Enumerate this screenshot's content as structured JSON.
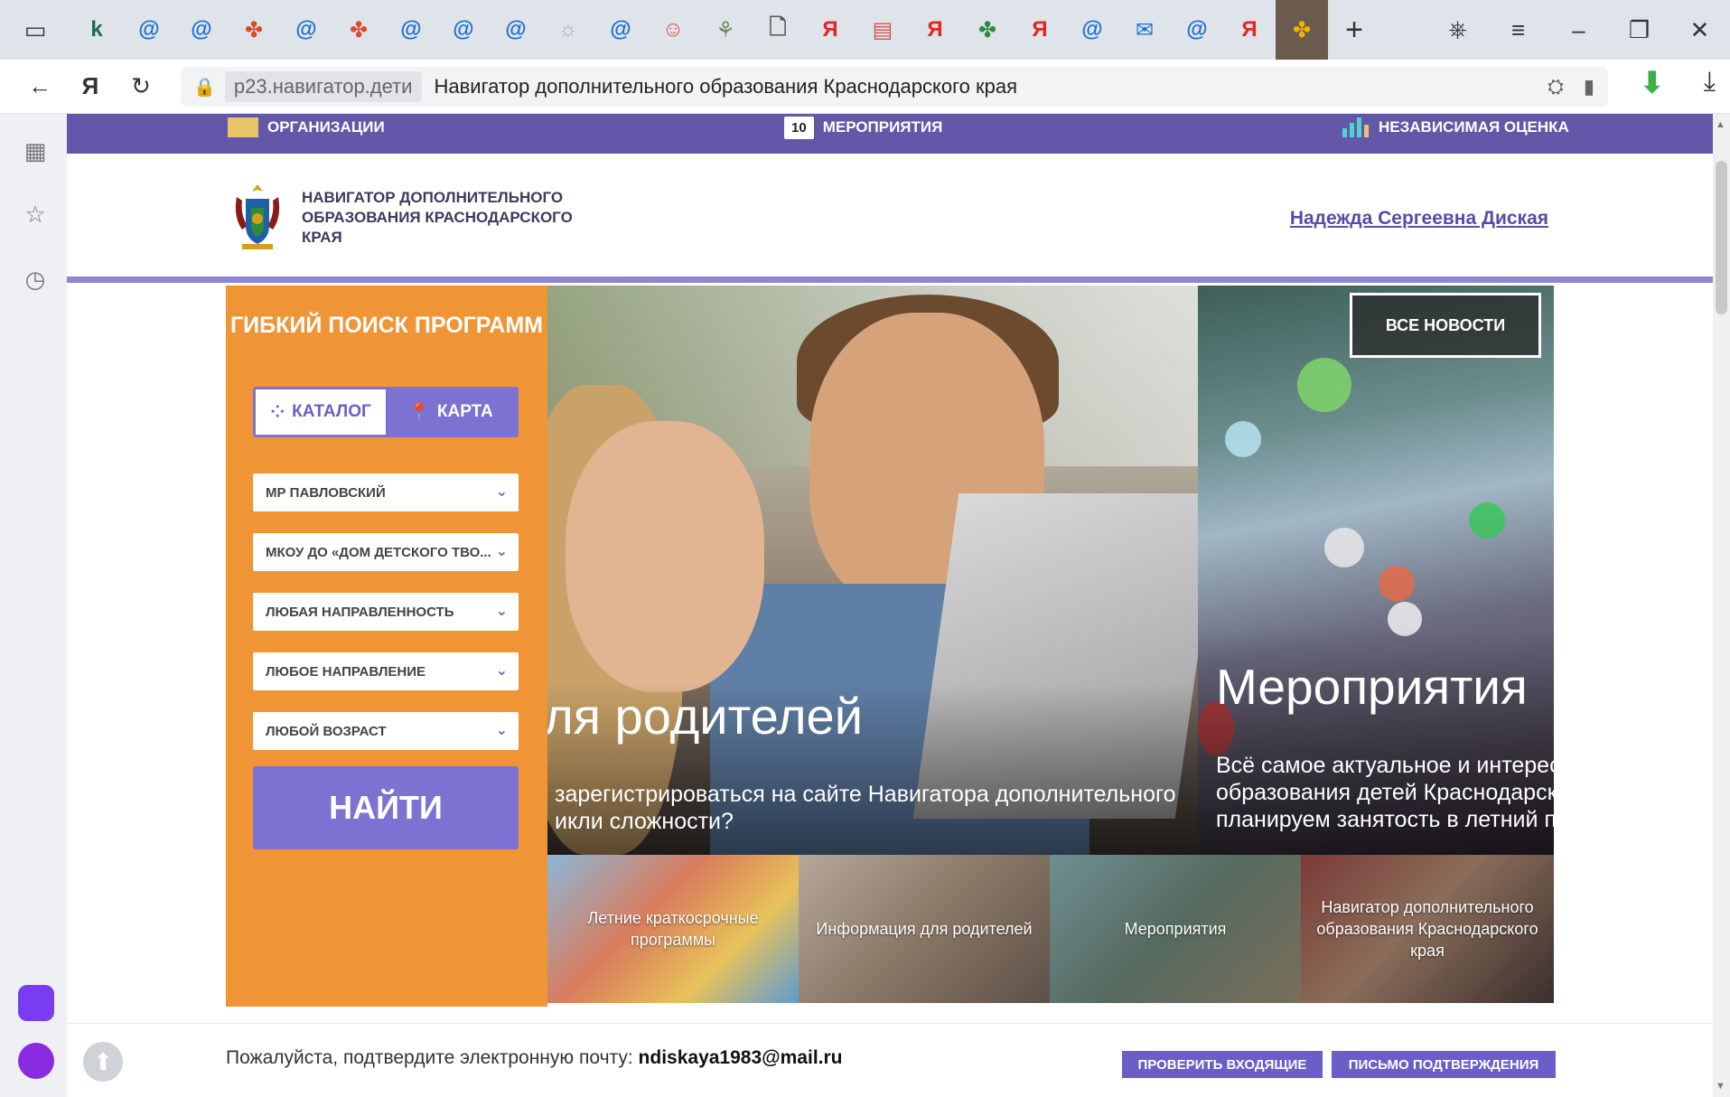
{
  "browser": {
    "tabs": [
      {
        "icon": "sidebar-toggle-icon",
        "glyph": "▭"
      },
      {
        "icon": "k-icon",
        "glyph": "k",
        "color": "#1f6b4a"
      },
      {
        "icon": "mail-icon",
        "glyph": "@",
        "color": "#1a6fd1"
      },
      {
        "icon": "mail-icon",
        "glyph": "@",
        "color": "#1a6fd1"
      },
      {
        "icon": "navigator-icon",
        "glyph": "✤",
        "color": "#d94b2b"
      },
      {
        "icon": "mail-icon",
        "glyph": "@",
        "color": "#1a6fd1"
      },
      {
        "icon": "navigator-icon",
        "glyph": "✤",
        "color": "#d94b2b"
      },
      {
        "icon": "mail-icon",
        "glyph": "@",
        "color": "#1a6fd1"
      },
      {
        "icon": "mail-icon",
        "glyph": "@",
        "color": "#1a6fd1"
      },
      {
        "icon": "mail-icon",
        "glyph": "@",
        "color": "#1a6fd1"
      },
      {
        "icon": "site-icon",
        "glyph": "☼",
        "color": "#b0b0b0"
      },
      {
        "icon": "mail-icon",
        "glyph": "@",
        "color": "#1a6fd1"
      },
      {
        "icon": "face-icon",
        "glyph": "☺",
        "color": "#d9534f"
      },
      {
        "icon": "figure-icon",
        "glyph": "⚘",
        "color": "#6a8a5a"
      },
      {
        "icon": "document-icon",
        "glyph": "🗋",
        "color": "#555555"
      },
      {
        "icon": "yandex-icon",
        "glyph": "Я",
        "color": "#e52620"
      },
      {
        "icon": "book-icon",
        "glyph": "▤",
        "color": "#d9534f"
      },
      {
        "icon": "yandex-icon",
        "glyph": "Я",
        "color": "#e52620"
      },
      {
        "icon": "navigator-icon",
        "glyph": "✤",
        "color": "#2b8a3e"
      },
      {
        "icon": "yandex-icon",
        "glyph": "Я",
        "color": "#e52620"
      },
      {
        "icon": "mail-icon",
        "glyph": "@",
        "color": "#1a6fd1"
      },
      {
        "icon": "envelope-icon",
        "glyph": "✉",
        "color": "#1a6fd1"
      },
      {
        "icon": "mail-icon",
        "glyph": "@",
        "color": "#1a6fd1"
      },
      {
        "icon": "yandex-icon",
        "glyph": "Я",
        "color": "#e52620"
      },
      {
        "icon": "navigator-icon",
        "glyph": "✤",
        "color": "#f0b400",
        "active": true
      }
    ],
    "new_tab_glyph": "+",
    "window_controls": [
      {
        "icon": "bookmarks-collection-icon",
        "glyph": "⎈"
      },
      {
        "icon": "menu-icon",
        "glyph": "≡"
      },
      {
        "icon": "minimize-icon",
        "glyph": "–"
      },
      {
        "icon": "restore-icon",
        "glyph": "❐"
      },
      {
        "icon": "close-icon",
        "glyph": "✕"
      }
    ],
    "nav": {
      "back": "←",
      "yandex": "Я",
      "reload": "↻"
    },
    "address": {
      "domain": "p23.навигатор.дети",
      "title": "Навигатор дополнительного образования Краснодарского края"
    }
  },
  "site": {
    "topnav": [
      {
        "label": "ОРГАНИЗАЦИИ",
        "icon": "building-icon"
      },
      {
        "label": "МЕРОПРИЯТИЯ",
        "badge": "10",
        "icon": "calendar-icon"
      },
      {
        "label": "НЕЗАВИСИМАЯ ОЦЕНКА",
        "icon": "chart-icon"
      }
    ],
    "logo_text": "Навигатор дополнительного образования Краснодарского края",
    "user_name": "Надежда Сергеевна Диская",
    "search": {
      "title": "Гибкий поиск программ",
      "segments": [
        {
          "label": "Каталог",
          "icon": "grid-icon",
          "active": true
        },
        {
          "label": "Карта",
          "icon": "map-pin-icon",
          "active": false
        }
      ],
      "filters": [
        "МР Павловский",
        "МКОУ ДО «Дом детского тво...",
        "Любая направленность",
        "Любое направление",
        "Любой возраст"
      ],
      "submit_label": "Найти"
    },
    "hero": {
      "title": "ля родителей",
      "text": "зарегистрироваться на сайте Навигатора дополнительного икли сложности?"
    },
    "events": {
      "all_news_label": "Все новости",
      "title": "Мероприятия",
      "text_lines": [
        "Всё самое актуальное и интересн",
        "образования детей Краснодарско",
        "планируем занятость в летний пе"
      ]
    },
    "thumbnails": [
      "Летние краткосрочные программы",
      "Информация для родителей",
      "Мероприятия",
      "Навигатор дополнительного образования Краснодарского края"
    ],
    "bottom": {
      "message": "Пожалуйста, подтвердите электронную почту:",
      "email": "ndiskaya1983@mail.ru",
      "check_inbox_label": "Проверить входящие",
      "confirm_letter_label": "Письмо подтверждения"
    }
  },
  "colors": {
    "purple": "#6257a8",
    "orange": "#ef9535",
    "button_purple": "#7b72d1"
  }
}
